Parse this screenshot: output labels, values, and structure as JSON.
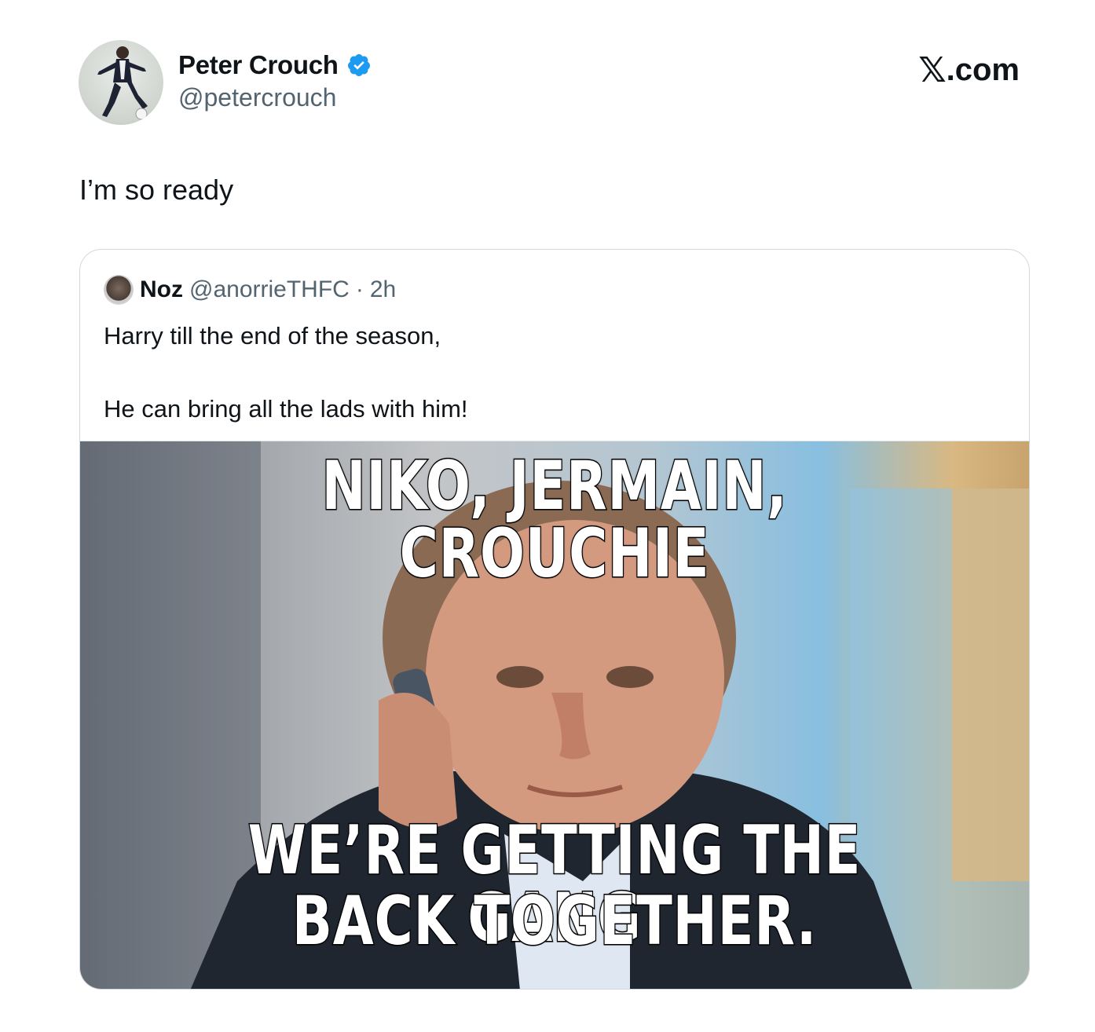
{
  "author": {
    "name": "Peter Crouch",
    "handle": "@petercrouch",
    "verified_icon": "verified-badge-icon",
    "verified_color": "#1d9bf0"
  },
  "brand": {
    "x": "𝕏",
    "suffix": ".com"
  },
  "tweet": {
    "text": "I’m so ready"
  },
  "quoted": {
    "name": "Noz",
    "handle": "@anorrieTHFC",
    "separator": "·",
    "time": "2h",
    "line1": "Harry till the end of the season,",
    "line2": "He can bring all the lads with him!",
    "image": {
      "caption_top": "NIKO, JERMAIN, CROUCHIE",
      "caption_bottom_1": "WE’RE GETTING THE GANG",
      "caption_bottom_2": "BACK TOGETHER."
    }
  },
  "colors": {
    "text": "#0f1419",
    "secondary": "#536471",
    "border": "#cfd9de"
  }
}
